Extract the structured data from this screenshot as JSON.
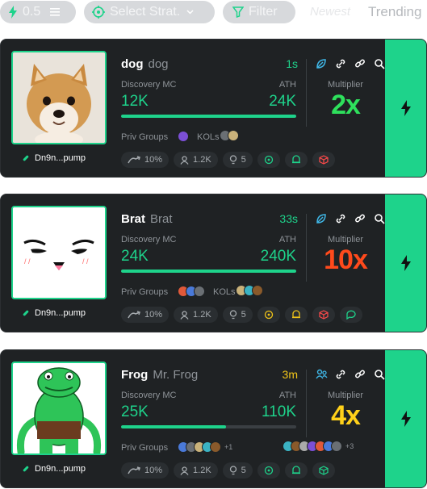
{
  "toolbar": {
    "amount_value": "0.5",
    "strategy_placeholder": "Select Strat.",
    "filter_label": "Filter",
    "tabs": [
      "Newest",
      "Trending"
    ]
  },
  "colors": {
    "accent_green": "#1ed38b",
    "multiplier_green": "#2ee05c",
    "multiplier_red": "#ff4a1c",
    "multiplier_yellow": "#ffd11a",
    "age_yellow": "#f0c419"
  },
  "cards": [
    {
      "name": "dog",
      "ticker": "dog",
      "age": "1s",
      "discovery_label": "Discovery MC",
      "discovery_value": "12K",
      "ath_label": "ATH",
      "ath_value": "24K",
      "progress": 1.0,
      "multiplier_label": "Multiplier",
      "multiplier": "2x",
      "address": "Dn9n...pump",
      "groups_label": "Priv Groups",
      "kols_label": "KOLs",
      "groups_more": "",
      "kols_more": "",
      "stat_growth": "10%",
      "stat_holders": "1.2K",
      "stat_pins": "5",
      "image": "shiba-inu-dog-photo"
    },
    {
      "name": "Brat",
      "ticker": "Brat",
      "age": "33s",
      "discovery_label": "Discovery MC",
      "discovery_value": "24K",
      "ath_label": "ATH",
      "ath_value": "240K",
      "progress": 1.0,
      "multiplier_label": "Multiplier",
      "multiplier": "10x",
      "address": "Dn9n...pump",
      "groups_label": "Priv Groups",
      "kols_label": "KOLs",
      "groups_more": "",
      "kols_more": "",
      "stat_growth": "10%",
      "stat_holders": "1.2K",
      "stat_pins": "5",
      "image": "smug-face-drawing"
    },
    {
      "name": "Frog",
      "ticker": "Mr. Frog",
      "age": "3m",
      "discovery_label": "Discovery MC",
      "discovery_value": "25K",
      "ath_label": "ATH",
      "ath_value": "110K",
      "progress": 0.6,
      "multiplier_label": "Multiplier",
      "multiplier": "4x",
      "address": "Dn9n...pump",
      "groups_label": "Priv Groups",
      "kols_label": "",
      "groups_more": "+1",
      "kols_more": "+3",
      "stat_growth": "10%",
      "stat_holders": "1.2K",
      "stat_pins": "5",
      "image": "green-frog-cartoon"
    }
  ]
}
